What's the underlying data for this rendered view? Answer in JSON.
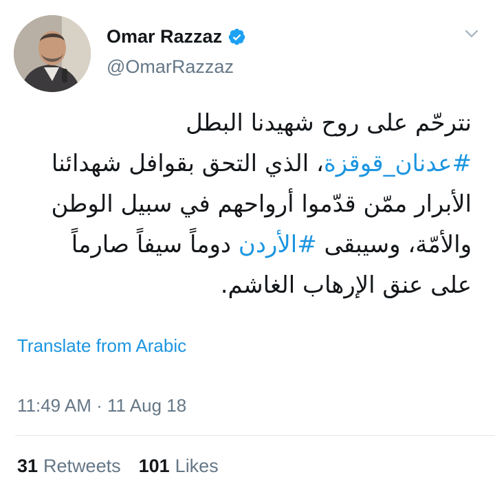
{
  "author": {
    "display_name": "Omar Razzaz",
    "handle": "@OmarRazzaz",
    "verified": true
  },
  "tweet": {
    "lines": [
      [
        {
          "text": "نترحّم على روح شهيدنا البطل",
          "hashtag": false
        }
      ],
      [
        {
          "text": "#عدنان_قوقزة",
          "hashtag": true
        },
        {
          "text": "، الذي التحق بقوافل شهدائنا",
          "hashtag": false
        }
      ],
      [
        {
          "text": "الأبرار ممّن قدّموا أرواحهم في سبيل الوطن",
          "hashtag": false
        }
      ],
      [
        {
          "text": "والأمّة، وسيبقى ",
          "hashtag": false
        },
        {
          "text": "#الأردن",
          "hashtag": true
        },
        {
          "text": " دوماً سيفاً صارماً",
          "hashtag": false
        }
      ],
      [
        {
          "text": "على عنق الإرهاب الغاشم.",
          "hashtag": false
        }
      ]
    ]
  },
  "translate_label": "Translate from Arabic",
  "timestamp": "11:49 AM · 11 Aug 18",
  "stats": {
    "retweets_count": "31",
    "retweets_label": "Retweets",
    "likes_count": "101",
    "likes_label": "Likes"
  },
  "colors": {
    "link": "#1b95e0",
    "secondary_text": "#657786",
    "primary_text": "#14171a",
    "verified_badge": "#1da1f2"
  },
  "icons": {
    "verified": "verified-badge-icon",
    "menu": "chevron-down-icon"
  }
}
